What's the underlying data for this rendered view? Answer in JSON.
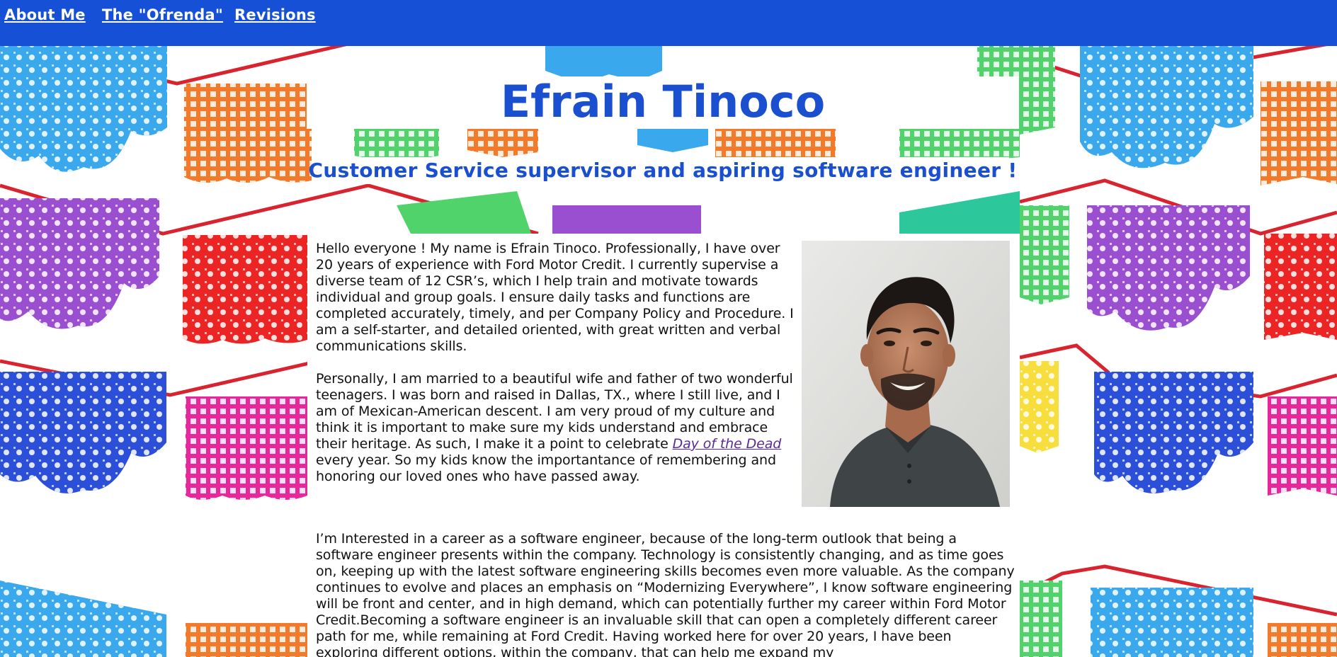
{
  "nav": {
    "items": [
      {
        "label": "About Me"
      },
      {
        "label": "The \"Ofrenda\""
      },
      {
        "label": "Revisions"
      }
    ]
  },
  "header": {
    "title": "Efrain Tinoco",
    "subtitle": "Customer Service supervisor and aspiring software engineer !"
  },
  "about": {
    "para1": "Hello everyone ! My name is Efrain Tinoco. Professionally, I have over 20 years of experience with Ford Motor Credit. I currently supervise a diverse team of 12 CSR’s, which I help train and motivate towards individual and group goals. I ensure daily tasks and functions are completed accurately, timely, and per Company Policy and Procedure. I am a self-starter, and detailed oriented, with great written and verbal communications skills.",
    "para2_before": "Personally, I am married to a beautiful wife and father of two wonderful teenagers. I was born and raised in Dallas, TX., where I still live, and I am of Mexican-American descent. I am very proud of my culture and think it is important to make sure my kids understand and embrace their heritage. As such, I make it a point to celebrate ",
    "para2_link": "Day of the Dead",
    "para2_after": " every year. So my kids know the importantance of remembering and honoring our loved ones who have passed away.",
    "para3": "I’m Interested in a career as a software engineer, because of the long-term outlook that being a software engineer presents within the company. Technology is consistently changing, and as time goes on, keeping up with the latest software engineering skills becomes even more valuable. As the company continues to evolve and places an emphasis on “Modernizing Everywhere”, I know software engineering will be front and center, and in high demand, which can potentially further my career within Ford Motor Credit.Becoming a software engineer is an invaluable skill that can open a completely different career path for me, while remaining at Ford Credit. Having worked here for over 20 years, I have been exploring different options, within the company, that can help me expand my"
  },
  "colors": {
    "nav_bg": "#1550d6",
    "title_text": "#1a4fcf",
    "link_text": "#5a2a9a",
    "banner_blue": "#3aa8ec",
    "banner_orange": "#f47a2a",
    "banner_green": "#4fd36a",
    "banner_purple": "#9a4fd0",
    "banner_red": "#ec2424",
    "banner_royal": "#2c4fd9",
    "banner_magenta": "#e8289a",
    "banner_yellow": "#f7de3c",
    "banner_teal": "#2cc79a"
  },
  "icons": {
    "portrait": "portrait-photo"
  }
}
